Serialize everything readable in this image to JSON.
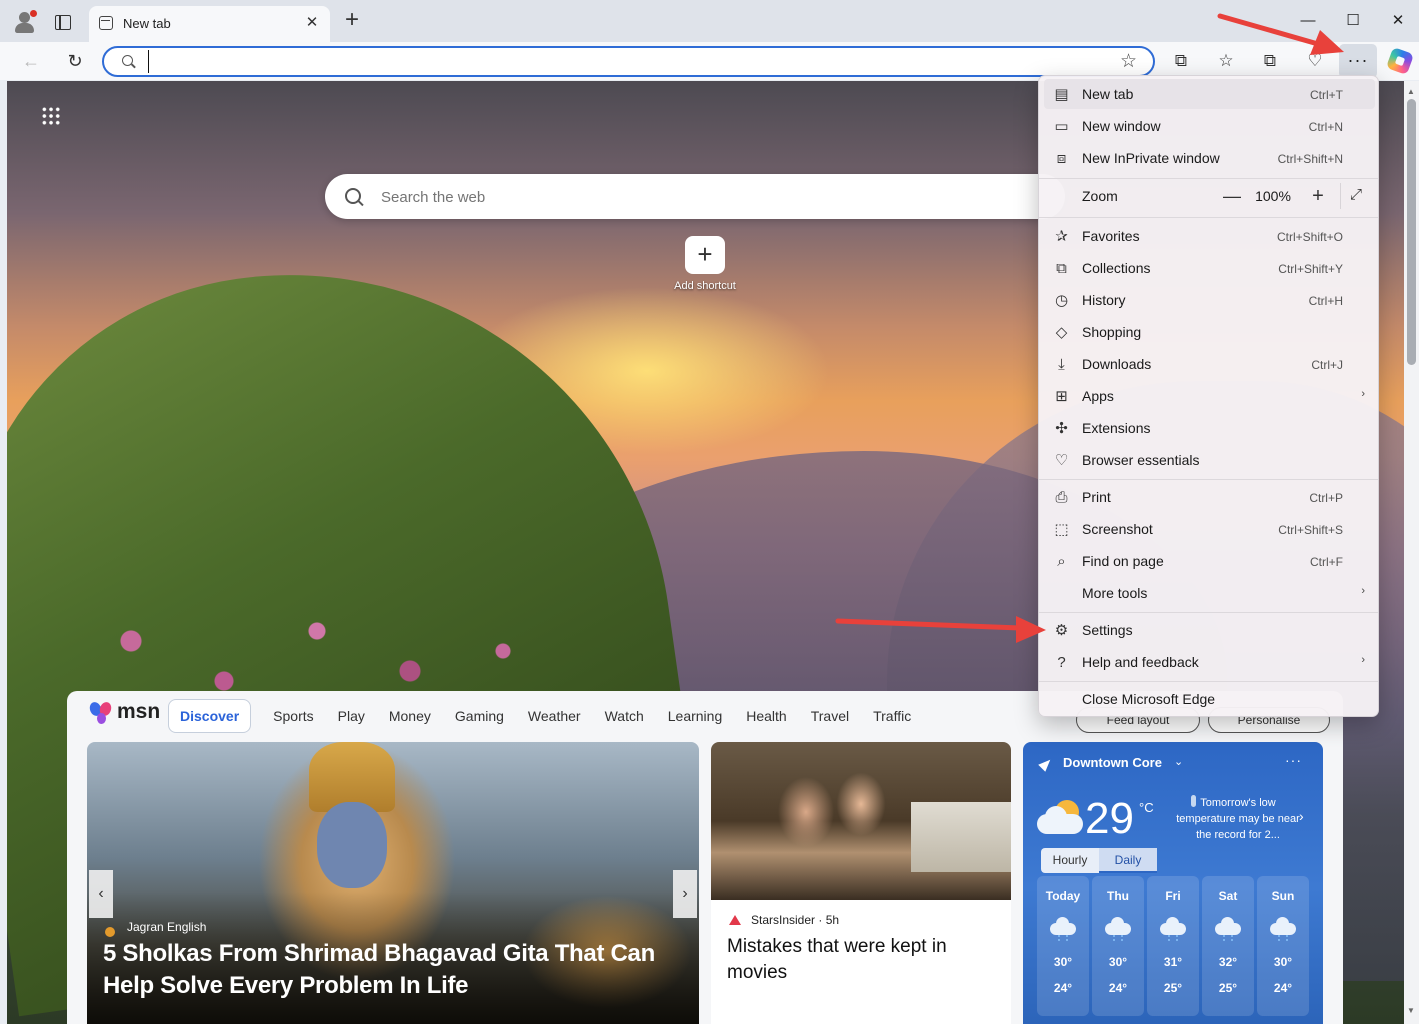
{
  "tab": {
    "title": "New tab",
    "close": "✕",
    "new_tab": "+"
  },
  "window": {
    "minimize": "—",
    "maximize": "☐",
    "close": "✕"
  },
  "toolbar": {
    "back": "←",
    "refresh": "↻",
    "address_value": "",
    "favorite_star": "☆",
    "split": "⧉",
    "favorites": "☆",
    "collections": "⧉",
    "browser_essentials": "♡",
    "more": "···"
  },
  "newtab": {
    "search_placeholder": "Search the web",
    "add_shortcut_icon": "+",
    "add_shortcut_label": "Add shortcut"
  },
  "feed": {
    "brand": "msn",
    "tabs": [
      "Discover",
      "Sports",
      "Play",
      "Money",
      "Gaming",
      "Weather",
      "Watch",
      "Learning",
      "Health",
      "Travel",
      "Traffic"
    ],
    "feed_layout": "Feed layout",
    "personalise": "Personalise",
    "main_card": {
      "source": "Jagran English",
      "title": "5 Sholkas From Shrimad Bhagavad Gita That Can Help Solve Every Problem In Life",
      "prev": "‹",
      "next": "›"
    },
    "second_card": {
      "source": "StarsInsider · 5h",
      "title": "Mistakes that were kept in movies"
    },
    "weather": {
      "location": "Downtown Core",
      "caret": "⌄",
      "more": "···",
      "temp": "29",
      "unit": "°C",
      "note": "Tomorrow's low temperature may be near the record for 2...",
      "chevron": "›",
      "toggle": [
        "Hourly",
        "Daily"
      ],
      "days": [
        {
          "day": "Today",
          "hi": "30°",
          "lo": "24°"
        },
        {
          "day": "Thu",
          "hi": "30°",
          "lo": "24°"
        },
        {
          "day": "Fri",
          "hi": "31°",
          "lo": "25°"
        },
        {
          "day": "Sat",
          "hi": "32°",
          "lo": "25°"
        },
        {
          "day": "Sun",
          "hi": "30°",
          "lo": "24°"
        }
      ]
    }
  },
  "menu": {
    "items": [
      {
        "label": "New tab",
        "shortcut": "Ctrl+T",
        "icon": "new-tab-icon"
      },
      {
        "label": "New window",
        "shortcut": "Ctrl+N",
        "icon": "new-window-icon"
      },
      {
        "label": "New InPrivate window",
        "shortcut": "Ctrl+Shift+N",
        "icon": "inprivate-icon"
      },
      {
        "label": "Zoom",
        "shortcut": "",
        "icon": ""
      },
      {
        "label": "Favorites",
        "shortcut": "Ctrl+Shift+O",
        "icon": "favorites-icon"
      },
      {
        "label": "Collections",
        "shortcut": "Ctrl+Shift+Y",
        "icon": "collections-icon"
      },
      {
        "label": "History",
        "shortcut": "Ctrl+H",
        "icon": "history-icon"
      },
      {
        "label": "Shopping",
        "shortcut": "",
        "icon": "shopping-tag-icon"
      },
      {
        "label": "Downloads",
        "shortcut": "Ctrl+J",
        "icon": "download-icon"
      },
      {
        "label": "Apps",
        "shortcut": "",
        "icon": "apps-icon"
      },
      {
        "label": "Extensions",
        "shortcut": "",
        "icon": "extensions-icon"
      },
      {
        "label": "Browser essentials",
        "shortcut": "",
        "icon": "heart-pulse-icon"
      },
      {
        "label": "Print",
        "shortcut": "Ctrl+P",
        "icon": "print-icon"
      },
      {
        "label": "Screenshot",
        "shortcut": "Ctrl+Shift+S",
        "icon": "screenshot-icon"
      },
      {
        "label": "Find on page",
        "shortcut": "Ctrl+F",
        "icon": "find-icon"
      },
      {
        "label": "More tools",
        "shortcut": "",
        "icon": ""
      },
      {
        "label": "Settings",
        "shortcut": "",
        "icon": "gear-icon"
      },
      {
        "label": "Help and feedback",
        "shortcut": "",
        "icon": "help-icon"
      },
      {
        "label": "Close Microsoft Edge",
        "shortcut": "",
        "icon": ""
      }
    ],
    "zoom_minus": "—",
    "zoom_value": "100%",
    "zoom_plus": "+",
    "zoom_fullscreen": "⤢",
    "submenu_arrow": "›"
  },
  "colors": {
    "accent": "#2f6cd6",
    "annotation_arrow": "#e8413b",
    "weather_bg": "#2d67c4"
  }
}
